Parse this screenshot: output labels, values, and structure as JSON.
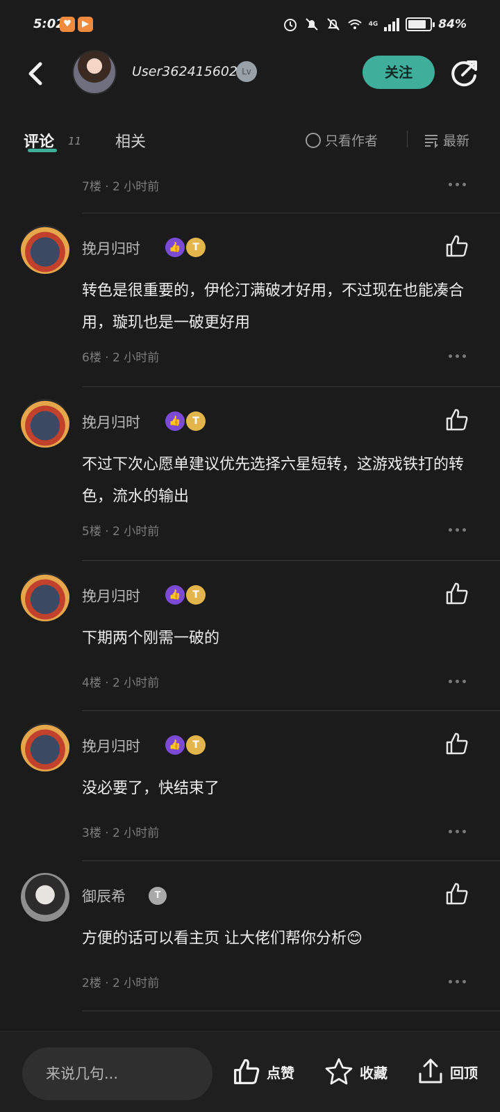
{
  "status_bar": {
    "time": "5:02",
    "network": "4G",
    "battery": "84%",
    "battery_level": 0.84
  },
  "header": {
    "author_name": "User362415602",
    "level_badge": "Lv",
    "follow_label": "关注"
  },
  "tabs": {
    "comments_label": "评论",
    "comments_count": "11",
    "related_label": "相关",
    "only_author_label": "只看作者",
    "sort_label": "最新"
  },
  "top_meta": {
    "floor_time": "7楼 · 2 小时前"
  },
  "comments": [
    {
      "name": "挽月归时",
      "text": "转色是很重要的，伊伦汀满破才好用，不过现在也能凑合用，璇玑也是一破更好用",
      "meta": "6楼 · 2 小时前"
    },
    {
      "name": "挽月归时",
      "text": "不过下次心愿单建议优先选择六星短转，这游戏铁打的转色，流水的输出",
      "meta": "5楼 · 2 小时前"
    },
    {
      "name": "挽月归时",
      "text": "下期两个刚需一破的",
      "meta": "4楼 · 2 小时前"
    },
    {
      "name": "挽月归时",
      "text": "没必要了，快结束了",
      "meta": "3楼 · 2 小时前"
    },
    {
      "name": "御辰希",
      "text": "方便的话可以看主页 让大佬们帮你分析😊",
      "meta": "2楼 · 2 小时前"
    }
  ],
  "badges": {
    "purple": "👍",
    "gold": "T",
    "gray": "T"
  },
  "bottom_bar": {
    "reply_placeholder": "来说几句...",
    "like_label": "点赞",
    "collect_label": "收藏",
    "top_label": "回顶"
  },
  "colors": {
    "background": "#1b1b1b",
    "accent": "#3fae9b",
    "badge_purple": "#7b4bd6",
    "badge_gold": "#e2b64a"
  }
}
